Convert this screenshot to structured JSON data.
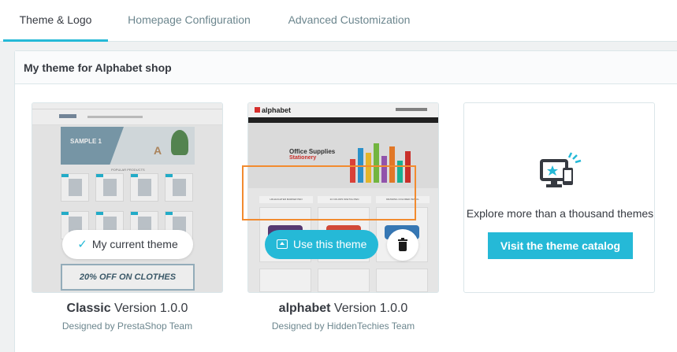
{
  "tabs": [
    {
      "label": "Theme & Logo",
      "active": true
    },
    {
      "label": "Homepage Configuration",
      "active": false
    },
    {
      "label": "Advanced Customization",
      "active": false
    }
  ],
  "panel": {
    "title": "My theme for Alphabet shop"
  },
  "themes": [
    {
      "name": "Classic",
      "version": "Version 1.0.0",
      "author": "Designed by PrestaShop Team",
      "badge_label": "My current theme",
      "preview": {
        "hero_title": "SAMPLE 1",
        "popular_title": "POPULAR PRODUCTS",
        "promo": "20% OFF ON CLOTHES"
      }
    },
    {
      "name": "alphabet",
      "version": "Version 1.0.0",
      "author": "Designed by HiddenTechies Team",
      "use_label": "Use this theme",
      "preview": {
        "logo": "alphabet",
        "hero_line1": "Office Supplies",
        "hero_line2": "Stationery",
        "strip": [
          "HIGHLIGHTER MARKER PEN",
          "24 COLORS SKETCH PEN",
          "DRAWING COLORED PENCIL"
        ]
      }
    }
  ],
  "catalog": {
    "text": "Explore more than a thousand themes",
    "button_label": "Visit the theme catalog"
  },
  "colors": {
    "accent": "#25b9d7",
    "highlight": "#f28b2f",
    "text": "#363a41",
    "muted": "#6c868e"
  },
  "icons": {
    "check": "check-icon",
    "upload": "upload-icon",
    "delete": "trash-icon",
    "catalog": "devices-icon"
  }
}
